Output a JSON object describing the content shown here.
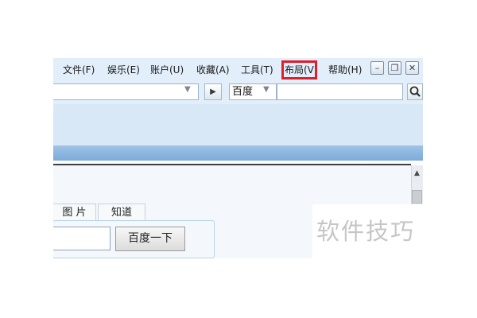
{
  "menu": {
    "items": [
      {
        "label": "文件(F)"
      },
      {
        "label": "娱乐(E)"
      },
      {
        "label": "账户(U)"
      },
      {
        "label": "收藏(A)"
      },
      {
        "label": "工具(T)"
      },
      {
        "label": "布局(V)"
      },
      {
        "label": "帮助(H)"
      }
    ],
    "highlight_color": "#e21d2a"
  },
  "window_controls": {
    "minimize": "–",
    "restore": "❐",
    "close": "✕"
  },
  "address_bar": {
    "url": "",
    "go_symbol": "▶",
    "dropdown_symbol": "▼"
  },
  "search_engine": {
    "selected": "百度",
    "dropdown_symbol": "▼",
    "query": ""
  },
  "page": {
    "tabs": [
      {
        "label": "图 片"
      },
      {
        "label": "知道"
      }
    ],
    "query": "",
    "search_button": "百度一下"
  },
  "scrollbar": {
    "up_symbol": "▲"
  },
  "watermark": "软件技巧"
}
